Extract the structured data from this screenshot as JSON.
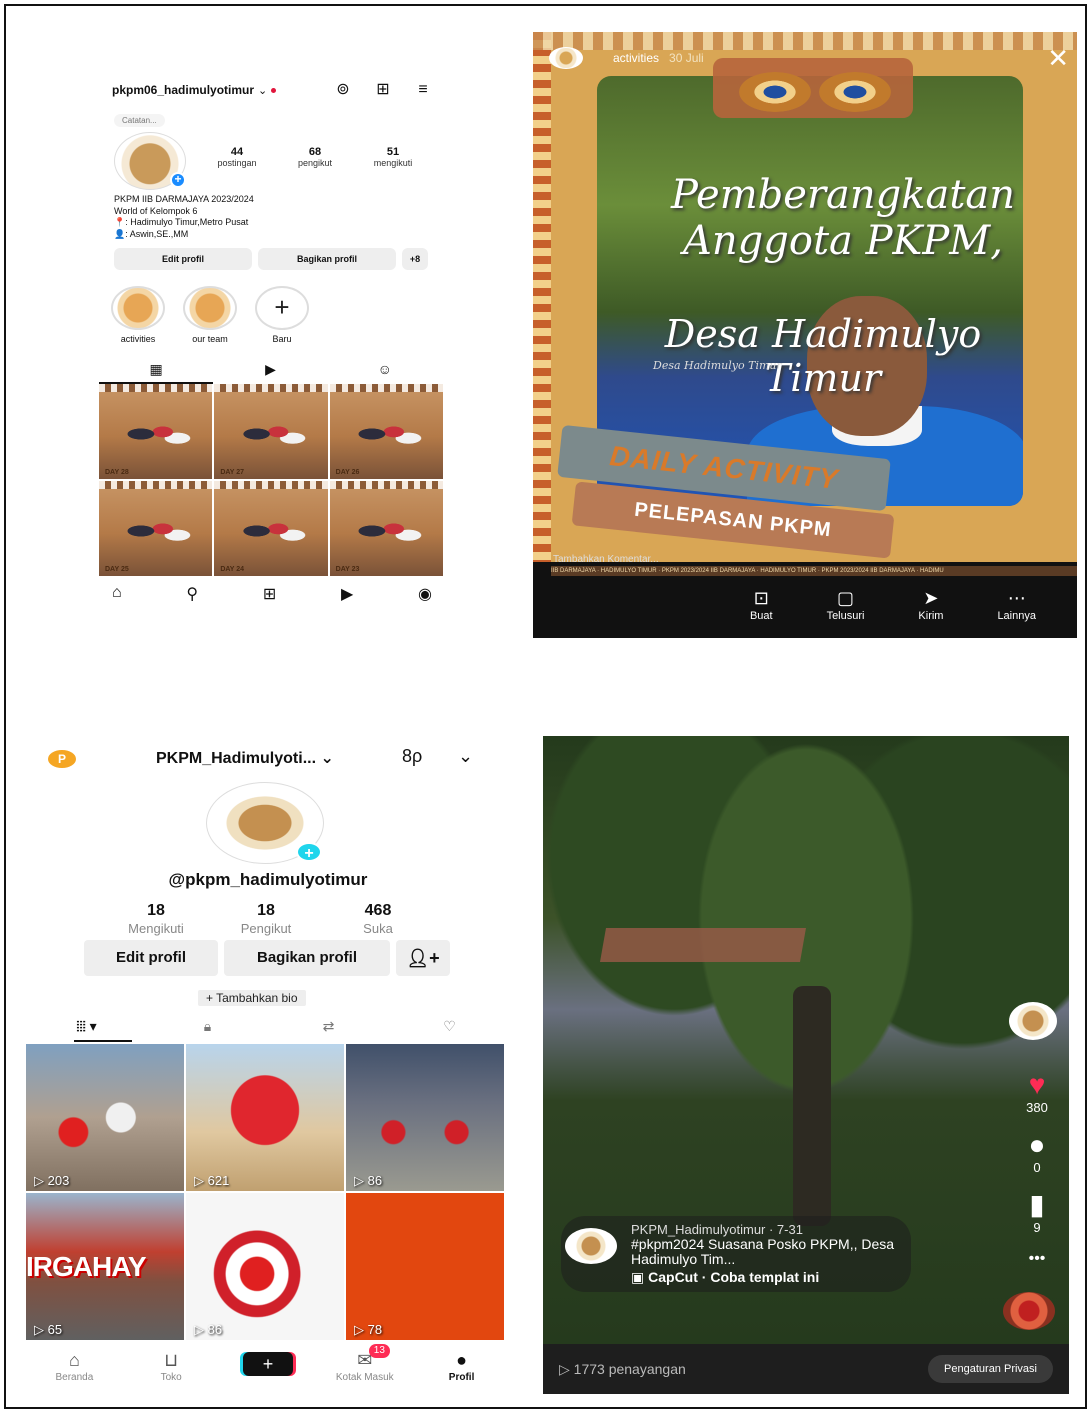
{
  "instagram_profile": {
    "username": "pkpm06_hadimulyotimur",
    "note": "Catatan...",
    "stats": [
      {
        "value": "44",
        "label": "postingan"
      },
      {
        "value": "68",
        "label": "pengikut"
      },
      {
        "value": "51",
        "label": "mengikuti"
      }
    ],
    "bio": [
      "PKPM IIB DARMAJAYA 2023/2024",
      "World of Kelompok 6",
      "📍: Hadimulyo Timur,Metro Pusat",
      "👤: Aswin,SE.,MM"
    ],
    "buttons": {
      "edit": "Edit profil",
      "share": "Bagikan profil",
      "add_person": "+8"
    },
    "highlights": [
      {
        "label": "activities"
      },
      {
        "label": "our team"
      },
      {
        "label": "Baru"
      }
    ],
    "new_highlight_symbol": "+",
    "tab_icons": [
      "grid-icon",
      "reels-icon",
      "tagged-icon"
    ],
    "tab_glyphs": [
      "▦",
      "▶",
      "☺"
    ],
    "posts": [
      {
        "day": "DAY 28"
      },
      {
        "day": "DAY 27"
      },
      {
        "day": "DAY 26"
      },
      {
        "day": "DAY 25"
      },
      {
        "day": "DAY 24"
      },
      {
        "day": "DAY 23"
      }
    ],
    "nav_icons": [
      "home-icon",
      "search-icon",
      "create-icon",
      "reels-icon",
      "profile-icon"
    ],
    "nav_glyphs": [
      "⌂",
      "⚲",
      "⊞",
      "▶",
      "◉"
    ],
    "dropdown_glyph": "⌄",
    "top_glyphs": [
      "⊚",
      "⊞",
      "≡"
    ]
  },
  "instagram_story": {
    "highlight_name": "activities",
    "time": "30 Juli",
    "close": "✕",
    "title_line1": "Pemberangkatan",
    "title_line2": "Anggota PKPM,",
    "title_line3": "Desa Hadimulyo Timur",
    "subtitle": "Desa Hadimulyo Timur",
    "banner1": "DAILY ACTIVITY",
    "banner2": "PELEPASAN PKPM",
    "comment_placeholder": "Tambahkan Komentar...",
    "ticker": "IIB DARMAJAYA · HADIMULYO TIMUR · PKPM 2023/2024 IIB DARMAJAYA · HADIMULYO TIMUR · PKPM 2023/2024 IIB DARMAJAYA · HADIMU",
    "actions": [
      {
        "label": "Buat",
        "icon": "create-icon",
        "glyph": "⊡"
      },
      {
        "label": "Telusuri",
        "icon": "explore-icon",
        "glyph": "▢"
      },
      {
        "label": "Kirim",
        "icon": "send-icon",
        "glyph": "➤"
      },
      {
        "label": "Lainnya",
        "icon": "more-icon",
        "glyph": "⋯"
      }
    ]
  },
  "tiktok_profile": {
    "badge_letter": "P",
    "title": "PKPM_Hadimulyoti... ⌄",
    "glyph_right1": "8ρ",
    "glyph_right2": "⌄",
    "handle": "@pkpm_hadimulyotimur",
    "stats": [
      {
        "value": "18",
        "label": "Mengikuti"
      },
      {
        "value": "18",
        "label": "Pengikut"
      },
      {
        "value": "468",
        "label": "Suka"
      }
    ],
    "buttons": {
      "edit": "Edit profil",
      "share": "Bagikan profil",
      "add": "+"
    },
    "add_bio": "+ Tambahkan bio",
    "tabs": [
      {
        "icon": "videos-grid-icon",
        "glyph": "⦙⦙⦙ ▾"
      },
      {
        "icon": "lock-icon",
        "glyph": "🔒︎"
      },
      {
        "icon": "repost-icon",
        "glyph": "⇄"
      },
      {
        "icon": "liked-icon",
        "glyph": "♡"
      }
    ],
    "videos": [
      {
        "views": "▷ 203"
      },
      {
        "views": "▷ 621"
      },
      {
        "views": "▷ 86"
      },
      {
        "views": "▷ 65",
        "overlay": "IRGAHAY"
      },
      {
        "views": "▷ 86"
      },
      {
        "views": "▷ 78"
      }
    ],
    "nav": [
      {
        "label": "Beranda",
        "icon": "home-icon",
        "glyph": "⌂"
      },
      {
        "label": "Toko",
        "icon": "shop-icon",
        "glyph": "⊔"
      },
      {
        "label": "",
        "icon": "create-icon",
        "glyph": "+"
      },
      {
        "label": "Kotak Masuk",
        "icon": "inbox-icon",
        "glyph": "✉",
        "badge": "13"
      },
      {
        "label": "Profil",
        "icon": "profile-icon",
        "glyph": "●"
      }
    ]
  },
  "tiktok_video": {
    "likes": "380",
    "comments": "0",
    "saves": "9",
    "icon_glyphs": {
      "like": "♥",
      "comment": "●",
      "save": "▮",
      "more": "•••"
    },
    "author_line": "PKPM_Hadimulyotimur · 7-31",
    "description": "#pkpm2024 Suasana Posko PKPM,, Desa Hadimulyo Tim...",
    "capcut": "▣ CapCut · Coba templat ini",
    "views": "▷  1773 penayangan",
    "privacy_button": "Pengaturan Privasi"
  }
}
